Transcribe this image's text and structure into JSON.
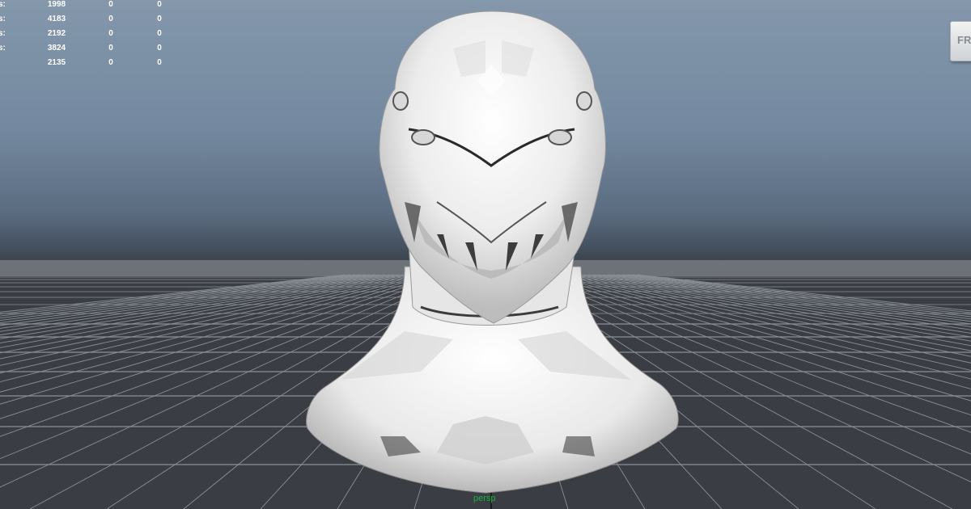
{
  "hud": {
    "rows": [
      {
        "label": "s:",
        "values": [
          "1998",
          "0",
          "0"
        ]
      },
      {
        "label": "s:",
        "values": [
          "4183",
          "0",
          "0"
        ]
      },
      {
        "label": "s:",
        "values": [
          "2192",
          "0",
          "0"
        ]
      },
      {
        "label": "s:",
        "values": [
          "3824",
          "0",
          "0"
        ]
      },
      {
        "label": "",
        "values": [
          "2135",
          "0",
          "0"
        ]
      }
    ]
  },
  "view_cube": {
    "label": "FRO"
  },
  "camera": {
    "label": "persp"
  },
  "colors": {
    "sky_top": "#8497ab",
    "ground": "#3a3e44",
    "grid_line": "#8a8f96",
    "camera_label": "#1faf3f",
    "model_light": "#f4f4f4",
    "model_shade": "#9a9a9a"
  },
  "icons": {
    "view_cube": "view-cube-icon"
  }
}
